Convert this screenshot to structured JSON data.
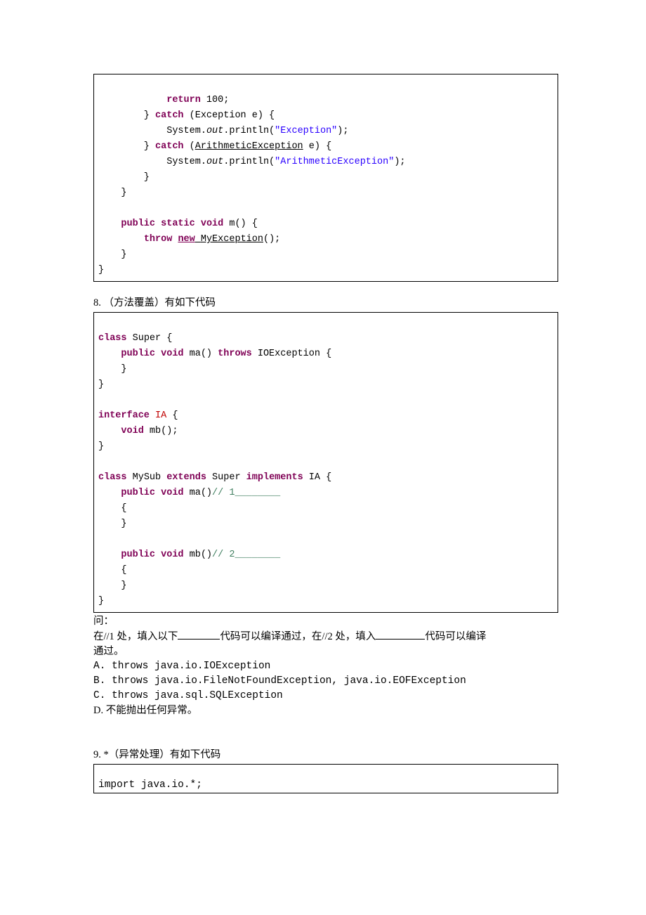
{
  "code1": {
    "l1a": "            ",
    "l1b": "return",
    "l1c": " 100;",
    "l2a": "        } ",
    "l2b": "catch",
    "l2c": " (Exception e) {",
    "l3a": "            System.",
    "l3b": "out",
    "l3c": ".println(",
    "l3d": "\"Exception\"",
    "l3e": ");",
    "l4a": "        } ",
    "l4b": "catch",
    "l4c": " (",
    "l4d": "ArithmeticException",
    "l4e": " e) {",
    "l5a": "            System.",
    "l5b": "out",
    "l5c": ".println(",
    "l5d": "\"ArithmeticException\"",
    "l5e": ");",
    "l6": "        }",
    "l7": "    }",
    "l8": "",
    "l9a": "    ",
    "l9b": "public",
    "l9c": " ",
    "l9d": "static",
    "l9e": " ",
    "l9f": "void",
    "l9g": " m() {",
    "l10a": "        ",
    "l10b": "throw",
    "l10c": " ",
    "l10d": "new",
    "l10e": " ",
    "l10f": "MyException",
    "l10g": "();",
    "l11": "    }",
    "l12": "}"
  },
  "q8": {
    "heading": "8. （方法覆盖）有如下代码",
    "code": {
      "l1a": "class",
      "l1b": " Super {",
      "l2a": "    ",
      "l2b": "public",
      "l2c": " ",
      "l2d": "void",
      "l2e": " ma() ",
      "l2f": "throws",
      "l2g": " IOException {",
      "l3": "    }",
      "l4": "}",
      "l5": "",
      "l6a": "interface",
      "l6b": " ",
      "l6c": "IA",
      "l6d": " {",
      "l7a": "    ",
      "l7b": "void",
      "l7c": " mb();",
      "l8": "}",
      "l9": "",
      "l10a": "class",
      "l10b": " MySub ",
      "l10c": "extends",
      "l10d": " Super ",
      "l10e": "implements",
      "l10f": " IA {",
      "l11a": "    ",
      "l11b": "public",
      "l11c": " ",
      "l11d": "void",
      "l11e": " ma()",
      "l11f": "// 1________",
      "l12": "    {",
      "l13": "    }",
      "l14": "",
      "l15a": "    ",
      "l15b": "public",
      "l15c": " ",
      "l15d": "void",
      "l15e": " mb()",
      "l15f": "// 2________",
      "l16": "    {",
      "l17": "    }",
      "l18": "}",
      "l19": ""
    },
    "question_label": "问：",
    "q_part1": "在//1 处，填入以下",
    "q_part2": "代码可以编译通过，在//2 处，填入",
    "q_part3": "代码可以编译",
    "q_part4": "通过。",
    "optA": "A. throws java.io.IOException",
    "optB": "B. throws java.io.FileNotFoundException, java.io.EOFException",
    "optC": "C. throws java.sql.SQLException",
    "optD": "D. 不能抛出任何异常。"
  },
  "q9": {
    "heading": "9. *（异常处理）有如下代码",
    "code": {
      "l1": "import java.io.*;"
    }
  }
}
